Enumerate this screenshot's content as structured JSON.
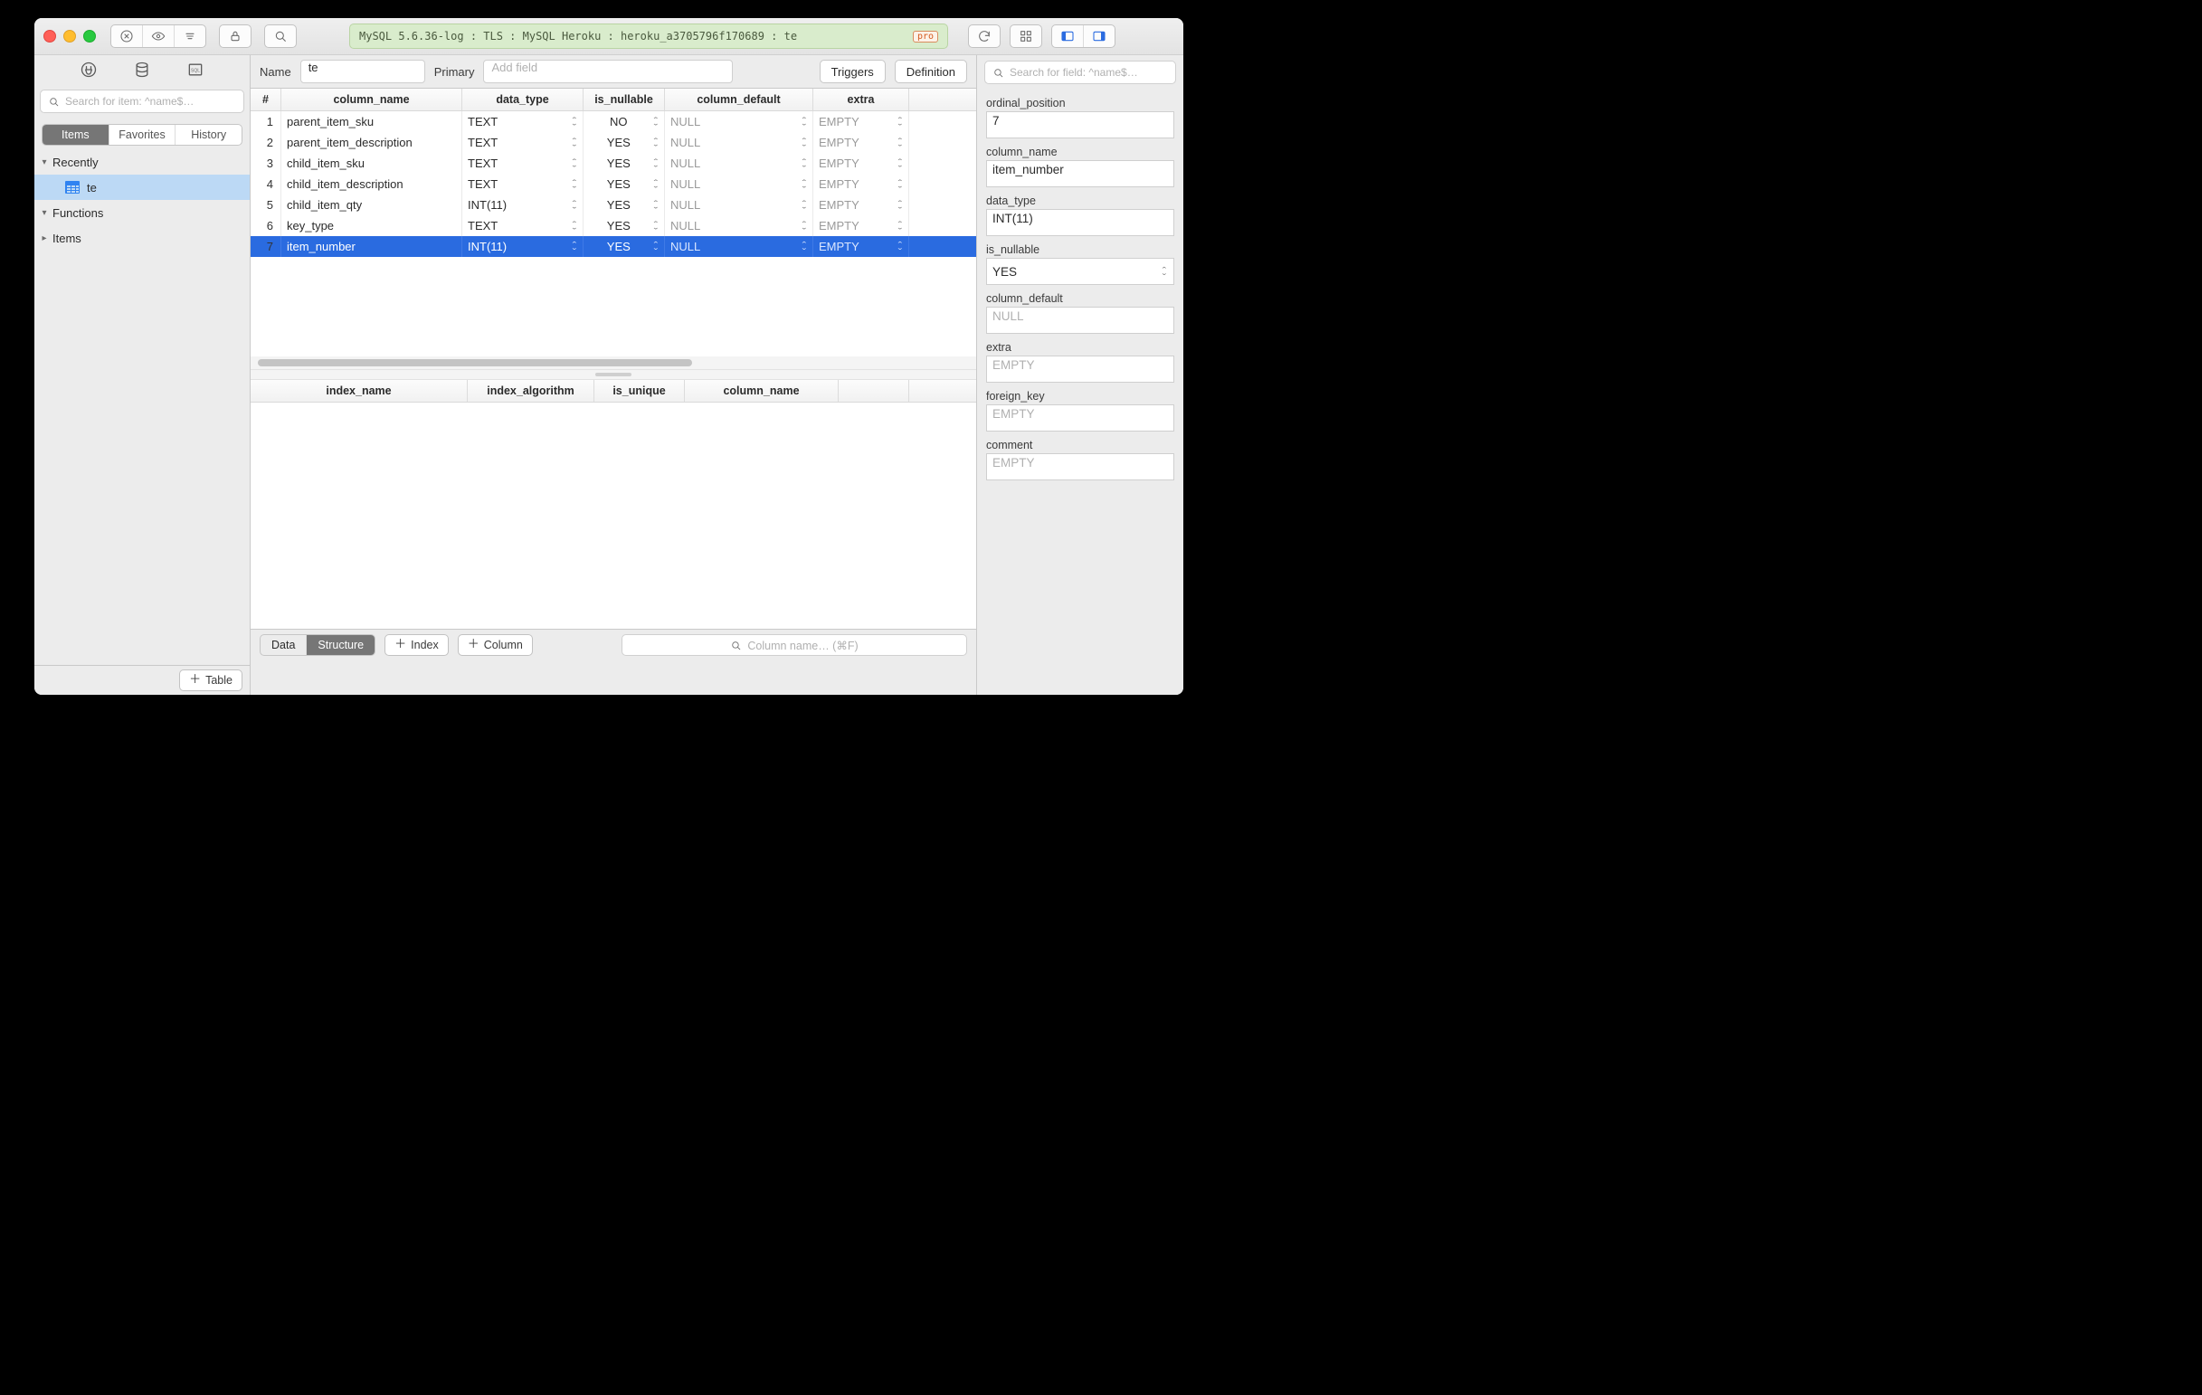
{
  "titlebar": {
    "connection": "MySQL 5.6.36-log : TLS : MySQL Heroku : heroku_a3705796f170689 : te",
    "pro_badge": "pro"
  },
  "sidebar": {
    "search_placeholder": "Search for item: ^name$…",
    "tabs": [
      "Items",
      "Favorites",
      "History"
    ],
    "active_tab": 0,
    "sections": [
      {
        "label": "Recently",
        "expanded": true,
        "children": [
          {
            "label": "te",
            "selected": true
          }
        ]
      },
      {
        "label": "Functions",
        "expanded": true,
        "children": []
      },
      {
        "label": "Items",
        "expanded": false,
        "children": []
      }
    ],
    "add_button": "Table"
  },
  "topform": {
    "name_label": "Name",
    "name_value": "te",
    "primary_label": "Primary",
    "add_field_placeholder": "Add field",
    "triggers_button": "Triggers",
    "definition_button": "Definition"
  },
  "columns_table": {
    "headers": [
      "#",
      "column_name",
      "data_type",
      "is_nullable",
      "column_default",
      "extra"
    ],
    "rows": [
      {
        "n": 1,
        "column_name": "parent_item_sku",
        "data_type": "TEXT",
        "is_nullable": "NO",
        "column_default": "NULL",
        "extra": "EMPTY"
      },
      {
        "n": 2,
        "column_name": "parent_item_description",
        "data_type": "TEXT",
        "is_nullable": "YES",
        "column_default": "NULL",
        "extra": "EMPTY"
      },
      {
        "n": 3,
        "column_name": "child_item_sku",
        "data_type": "TEXT",
        "is_nullable": "YES",
        "column_default": "NULL",
        "extra": "EMPTY"
      },
      {
        "n": 4,
        "column_name": "child_item_description",
        "data_type": "TEXT",
        "is_nullable": "YES",
        "column_default": "NULL",
        "extra": "EMPTY"
      },
      {
        "n": 5,
        "column_name": "child_item_qty",
        "data_type": "INT(11)",
        "is_nullable": "YES",
        "column_default": "NULL",
        "extra": "EMPTY"
      },
      {
        "n": 6,
        "column_name": "key_type",
        "data_type": "TEXT",
        "is_nullable": "YES",
        "column_default": "NULL",
        "extra": "EMPTY"
      },
      {
        "n": 7,
        "column_name": "item_number",
        "data_type": "INT(11)",
        "is_nullable": "YES",
        "column_default": "NULL",
        "extra": "EMPTY",
        "selected": true
      }
    ]
  },
  "index_table": {
    "headers": [
      "index_name",
      "index_algorithm",
      "is_unique",
      "column_name",
      ""
    ]
  },
  "bottombar": {
    "tabs": [
      "Data",
      "Structure"
    ],
    "active_tab": 1,
    "add_index": "Index",
    "add_column": "Column",
    "search_placeholder": "Column name… (⌘F)"
  },
  "inspector": {
    "search_placeholder": "Search for field: ^name$…",
    "fields": [
      {
        "key": "ordinal_position",
        "label": "ordinal_position",
        "value": "7"
      },
      {
        "key": "column_name",
        "label": "column_name",
        "value": "item_number"
      },
      {
        "key": "data_type",
        "label": "data_type",
        "value": "INT(11)"
      },
      {
        "key": "is_nullable",
        "label": "is_nullable",
        "value": "YES",
        "select": true
      },
      {
        "key": "column_default",
        "label": "column_default",
        "value": "NULL",
        "placeholder": true
      },
      {
        "key": "extra",
        "label": "extra",
        "value": "EMPTY",
        "placeholder": true
      },
      {
        "key": "foreign_key",
        "label": "foreign_key",
        "value": "EMPTY",
        "placeholder": true
      },
      {
        "key": "comment",
        "label": "comment",
        "value": "EMPTY",
        "placeholder": true
      }
    ]
  }
}
